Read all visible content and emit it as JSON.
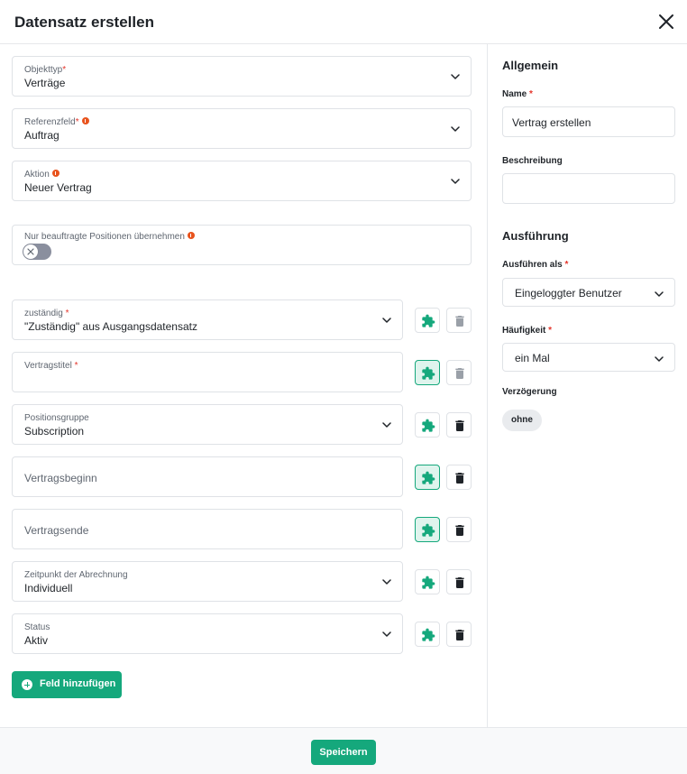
{
  "dialog": {
    "title": "Datensatz erstellen",
    "close_icon": "close-icon"
  },
  "main": {
    "objekttyp": {
      "label": "Objekttyp",
      "required": "*",
      "value": "Verträge"
    },
    "referenzfeld": {
      "label": "Referenzfeld",
      "required": "*",
      "value": "Auftrag"
    },
    "aktion": {
      "label": "Aktion",
      "value": "Neuer Vertrag"
    },
    "toggle": {
      "label": "Nur beauftragte Positionen übernehmen",
      "enabled": false
    },
    "fields": [
      {
        "label": "zuständig",
        "required": "*",
        "value": "\"Zuständig\" aus Ausgangsdatensatz",
        "type": "select"
      },
      {
        "label": "Vertragstitel",
        "required": "*",
        "value": "",
        "type": "text"
      },
      {
        "label": "Positionsgruppe",
        "value": "Subscription",
        "type": "select"
      },
      {
        "placeholder": "Vertragsbeginn",
        "type": "date"
      },
      {
        "placeholder": "Vertragsende",
        "type": "date"
      },
      {
        "label": "Zeitpunkt der Abrechnung",
        "value": "Individuell",
        "type": "select"
      },
      {
        "label": "Status",
        "value": "Aktiv",
        "type": "select"
      }
    ],
    "add_field_label": "Feld hinzufügen"
  },
  "sidebar": {
    "section_general": "Allgemein",
    "name": {
      "label": "Name",
      "required": "*",
      "value": "Vertrag erstellen"
    },
    "description": {
      "label": "Beschreibung",
      "value": ""
    },
    "section_execution": "Ausführung",
    "execute_as": {
      "label": "Ausführen als",
      "required": "*",
      "value": "Eingeloggter Benutzer"
    },
    "frequency": {
      "label": "Häufigkeit",
      "required": "*",
      "value": "ein Mal"
    },
    "delay": {
      "label": "Verzögerung",
      "value": "ohne"
    }
  },
  "footer": {
    "save_label": "Speichern"
  },
  "colors": {
    "accent": "#15a87c",
    "required": "#e4352b",
    "info": "#e8531d"
  }
}
